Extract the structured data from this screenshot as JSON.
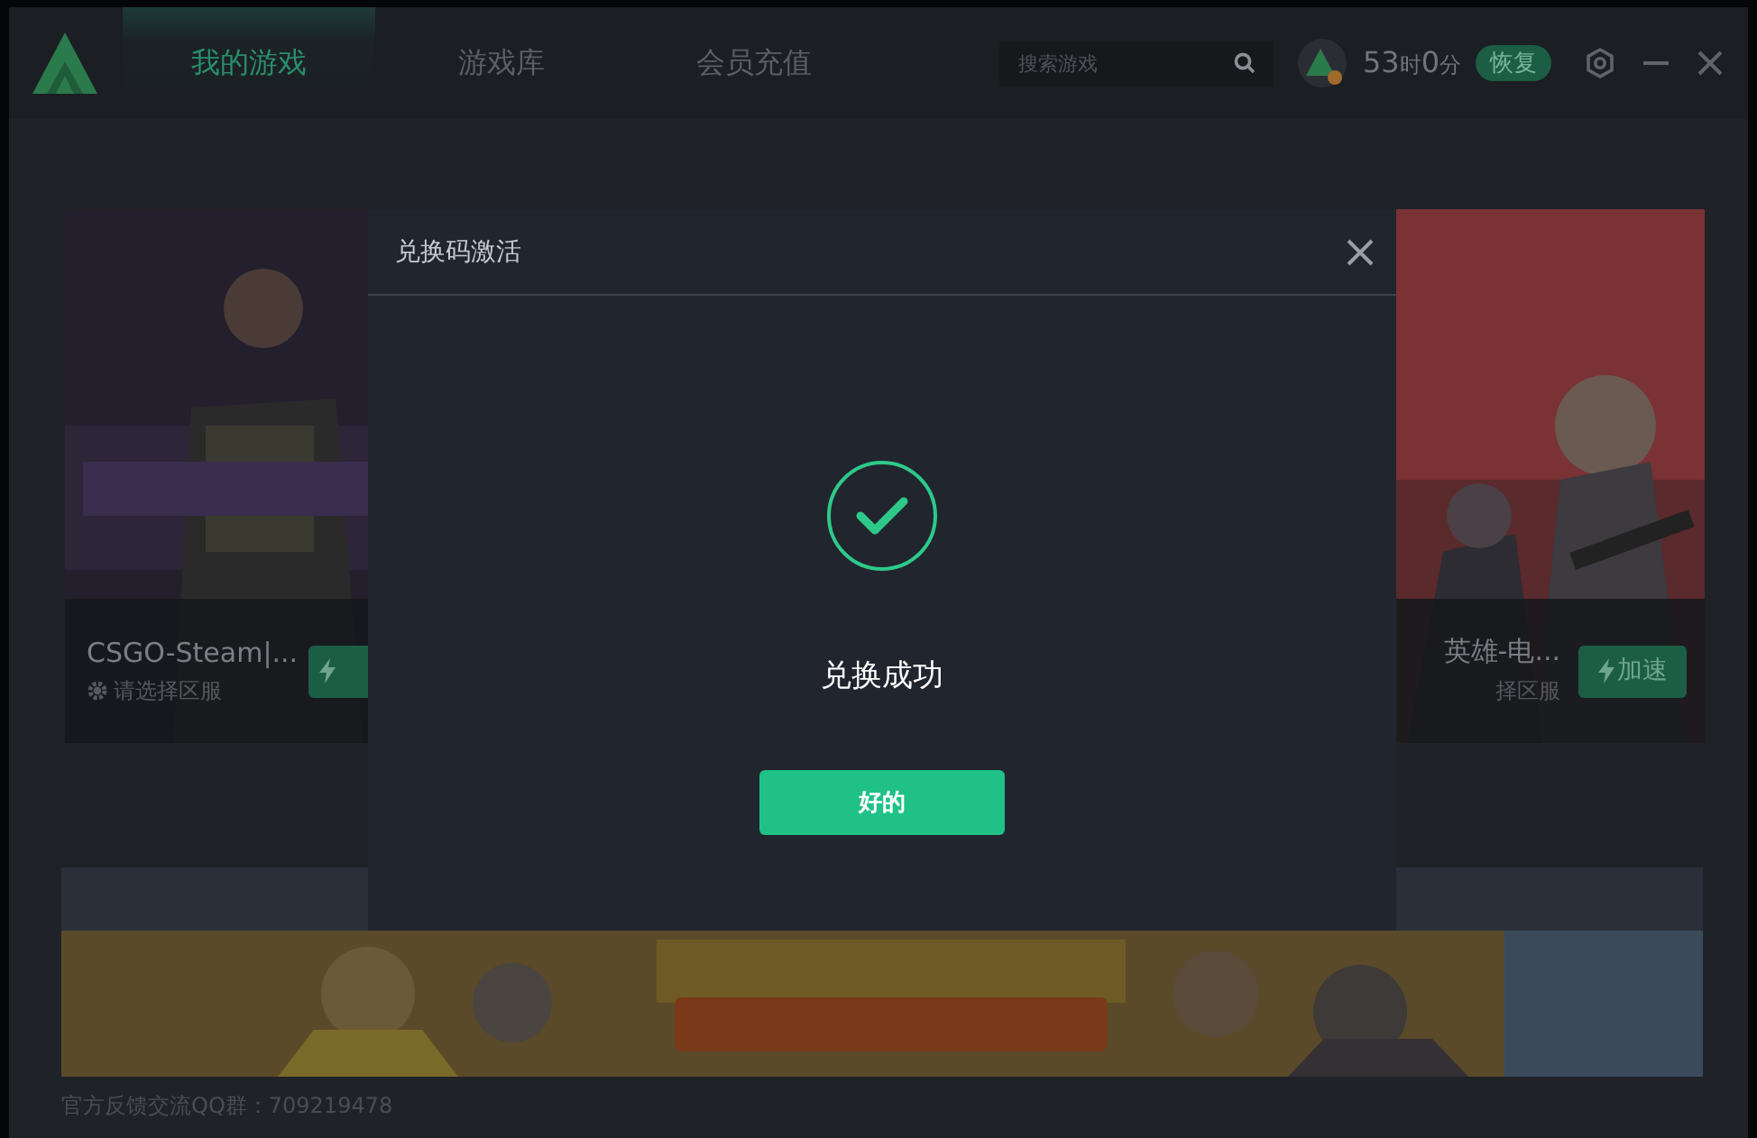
{
  "app": {
    "tabs": [
      {
        "label": "我的游戏",
        "selected": true
      },
      {
        "label": "游戏库",
        "selected": false
      },
      {
        "label": "会员充值",
        "selected": false
      }
    ],
    "search": {
      "placeholder": "搜索游戏"
    },
    "time_left": [
      {
        "text": "53",
        "kind": "number"
      },
      {
        "text": "时",
        "kind": "unit"
      },
      {
        "text": "0",
        "kind": "number"
      },
      {
        "text": "分",
        "kind": "unit"
      }
    ],
    "resume_button": "恢复"
  },
  "games": [
    {
      "title": "CSGO-Steam|...",
      "server": "请选择区服",
      "kind": "picture"
    },
    {
      "title": "英雄-电...",
      "server": "择区服",
      "button_label": "加速",
      "kind": "picture"
    }
  ],
  "footer": "官方反馈交流QQ群：709219478",
  "dialog": {
    "title": "兑换码激活",
    "message": "兑换成功",
    "ok_button": "好的"
  }
}
